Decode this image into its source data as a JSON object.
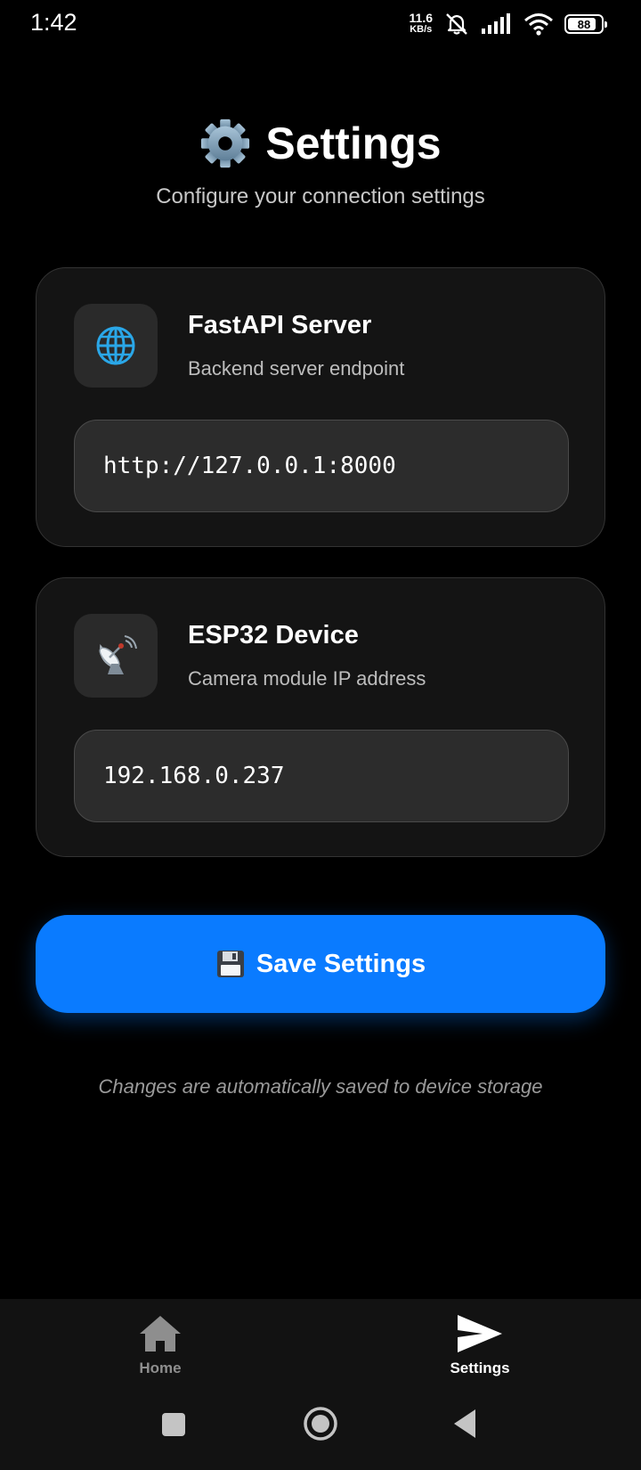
{
  "status_bar": {
    "time": "1:42",
    "net_speed_value": "11.6",
    "net_speed_unit": "KB/s",
    "battery_level": "88",
    "icons": [
      "mute-icon",
      "signal-icon",
      "wifi-icon",
      "battery-icon"
    ]
  },
  "header": {
    "title": "Settings",
    "title_icon": "gear-icon",
    "subtitle": "Configure your connection settings"
  },
  "cards": [
    {
      "icon": "globe-icon",
      "title": "FastAPI Server",
      "description": "Backend server endpoint",
      "input_value": "http://127.0.0.1:8000"
    },
    {
      "icon": "satellite-dish-icon",
      "title": "ESP32 Device",
      "description": "Camera module IP address",
      "input_value": "192.168.0.237"
    }
  ],
  "save_button": {
    "icon": "floppy-disk-icon",
    "label": "Save Settings"
  },
  "footnote": "Changes are automatically saved to device storage",
  "tab_bar": {
    "tabs": [
      {
        "label": "Home",
        "icon": "home-icon",
        "active": false
      },
      {
        "label": "Settings",
        "icon": "send-icon",
        "active": true
      }
    ]
  },
  "system_nav": [
    "recents-button",
    "home-button",
    "back-button"
  ],
  "colors": {
    "accent": "#0a7bff",
    "background": "#000000",
    "card": "#141414",
    "input": "#2c2c2c",
    "muted_text": "#bdbdbd"
  }
}
